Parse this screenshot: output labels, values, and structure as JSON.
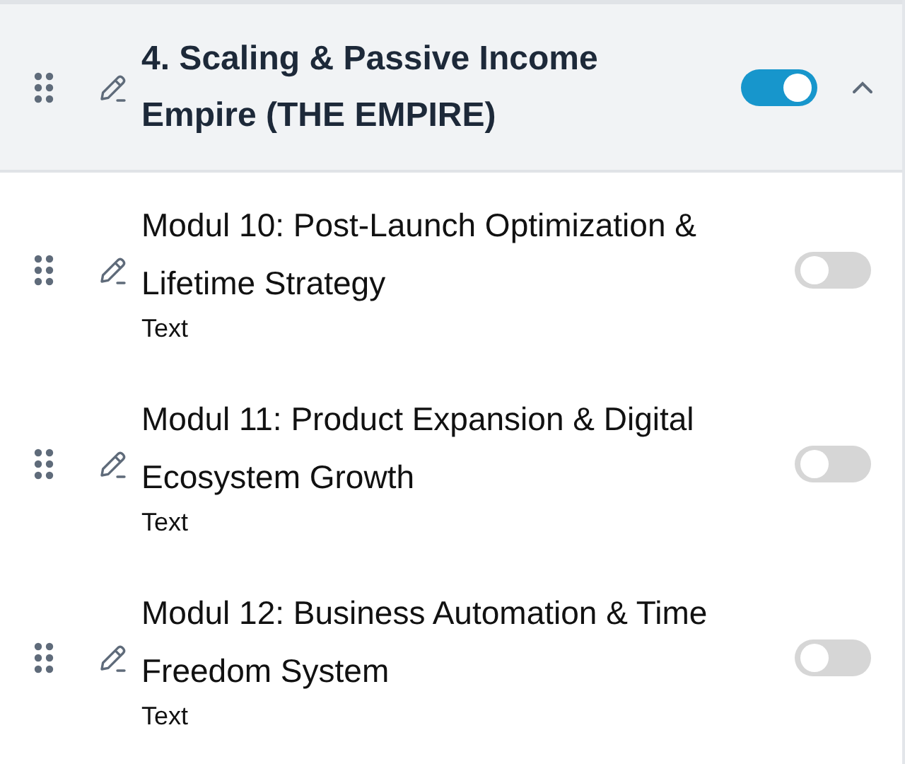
{
  "section": {
    "title": "4. Scaling & Passive Income Empire (THE EMPIRE)",
    "on": true,
    "expanded": true
  },
  "modules": [
    {
      "title": "Modul 10: Post-Launch Optimization & Lifetime Strategy",
      "type_label": "Text",
      "on": false
    },
    {
      "title": "Modul 11: Product Expansion & Digital Ecosystem Growth",
      "type_label": "Text",
      "on": false
    },
    {
      "title": "Modul 12: Business Automation & Time Freedom System",
      "type_label": "Text",
      "on": false
    }
  ]
}
